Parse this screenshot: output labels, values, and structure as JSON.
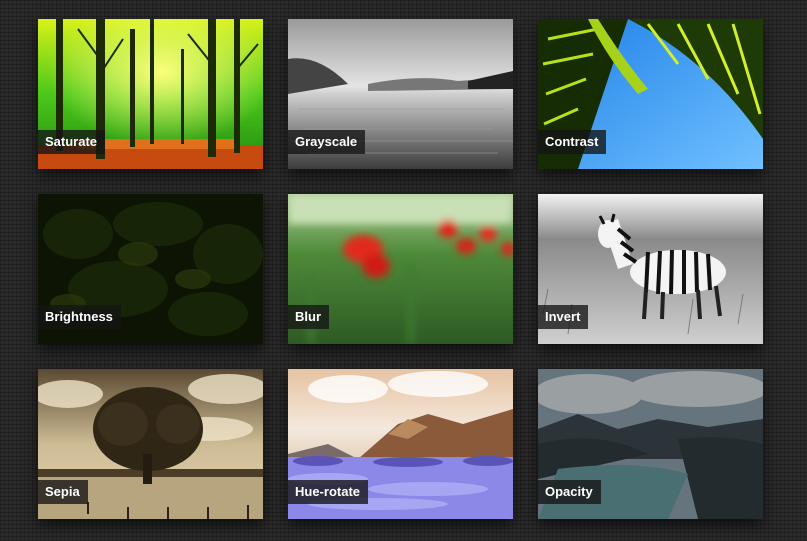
{
  "gallery": {
    "tiles": [
      {
        "label": "Saturate"
      },
      {
        "label": "Grayscale"
      },
      {
        "label": "Contrast"
      },
      {
        "label": "Brightness"
      },
      {
        "label": "Blur"
      },
      {
        "label": "Invert"
      },
      {
        "label": "Sepia"
      },
      {
        "label": "Hue-rotate"
      },
      {
        "label": "Opacity"
      }
    ]
  }
}
